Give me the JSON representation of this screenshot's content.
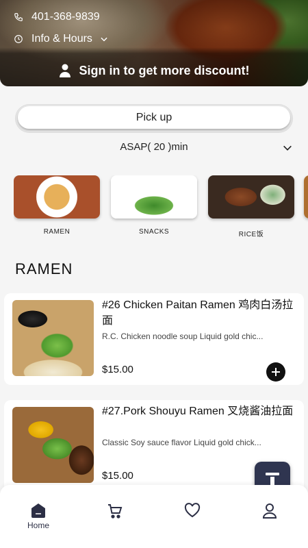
{
  "header": {
    "phone": "401-368-9839",
    "info_hours": "Info & Hours",
    "signin_text": "Sign in to get more discount!"
  },
  "order": {
    "mode_label": "Pick up",
    "time_label": "ASAP( 20 )min"
  },
  "categories": [
    {
      "label": "RAMEN",
      "icon": "ramen-image"
    },
    {
      "label": "SNACKS",
      "icon": "seaweed-salad-image"
    },
    {
      "label": "RICE饭",
      "icon": "rice-bowl-image"
    }
  ],
  "section": {
    "title": "RAMEN"
  },
  "items": [
    {
      "title": "#26 Chicken Paitan Ramen 鸡肉白汤拉面",
      "desc": "R.C. Chicken noodle soup Liquid gold chic...",
      "price": "$15.00"
    },
    {
      "title": "#27.Pork Shouyu Ramen 叉烧酱油拉面",
      "desc": "Classic Soy sauce flavor Liquid gold chick...",
      "price": "$15.00"
    }
  ],
  "nav": {
    "items": [
      {
        "label": "Home",
        "icon": "home-icon"
      },
      {
        "label": "",
        "icon": "cart-icon"
      },
      {
        "label": "",
        "icon": "heart-icon"
      },
      {
        "label": "",
        "icon": "user-icon"
      }
    ]
  },
  "colors": {
    "accent": "#2f3550",
    "button_dark": "#111111",
    "background": "#f5f5f5"
  }
}
